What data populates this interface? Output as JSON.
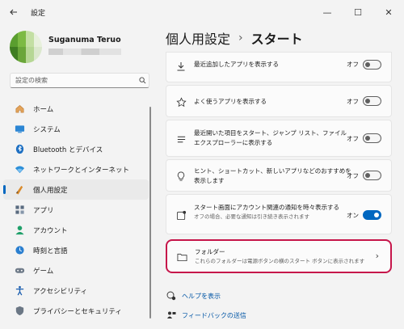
{
  "app": {
    "title": "設定"
  },
  "window_controls": {
    "minimize": "—",
    "maximize": "☐",
    "close": "✕"
  },
  "user": {
    "name": "Suganuma Teruo"
  },
  "search": {
    "placeholder": "設定の検索"
  },
  "sidebar": {
    "items": [
      {
        "label": "ホーム",
        "icon": "home-icon"
      },
      {
        "label": "システム",
        "icon": "system-icon"
      },
      {
        "label": "Bluetooth とデバイス",
        "icon": "bluetooth-icon"
      },
      {
        "label": "ネットワークとインターネット",
        "icon": "network-icon"
      },
      {
        "label": "個人用設定",
        "icon": "personalization-icon",
        "selected": true
      },
      {
        "label": "アプリ",
        "icon": "apps-icon"
      },
      {
        "label": "アカウント",
        "icon": "account-icon"
      },
      {
        "label": "時刻と言語",
        "icon": "time-language-icon"
      },
      {
        "label": "ゲーム",
        "icon": "gaming-icon"
      },
      {
        "label": "アクセシビリティ",
        "icon": "accessibility-icon"
      },
      {
        "label": "プライバシーとセキュリティ",
        "icon": "privacy-icon"
      }
    ]
  },
  "breadcrumb": {
    "parent": "個人用設定",
    "separator": "›",
    "current": "スタート"
  },
  "settings": [
    {
      "label": "最近追加したアプリを表示する",
      "state": "オフ",
      "on": false,
      "icon": "download-icon"
    },
    {
      "label": "よく使うアプリを表示する",
      "state": "オフ",
      "on": false,
      "icon": "star-icon"
    },
    {
      "label": "最近開いた項目をスタート、ジャンプ リスト、ファイル エクスプローラーに表示する",
      "line1": "最近開いた項目をスタート、ジャンプ リスト、ファイル",
      "line2": "エクスプローラーに表示する",
      "state": "オフ",
      "on": false,
      "icon": "list-icon"
    },
    {
      "line1": "ヒント、ショートカット、新しいアプリなどのおすすめを",
      "line2": "表示します",
      "state": "オフ",
      "on": false,
      "icon": "lightbulb-icon"
    },
    {
      "line1": "スタート画面にアカウント関連の通知を時々表示する",
      "sub": "オフの場合、必要な通知は引き続き表示されます",
      "state": "オン",
      "on": true,
      "icon": "notification-icon"
    }
  ],
  "folders": {
    "title": "フォルダー",
    "description": "これらのフォルダーは電源ボタンの横のスタート ボタンに表示されます"
  },
  "links": [
    {
      "label": "ヘルプを表示",
      "icon": "help-icon"
    },
    {
      "label": "フィードバックの送信",
      "icon": "feedback-icon"
    }
  ],
  "colors": {
    "accent": "#0067c0",
    "highlight_border": "#c6154a"
  }
}
